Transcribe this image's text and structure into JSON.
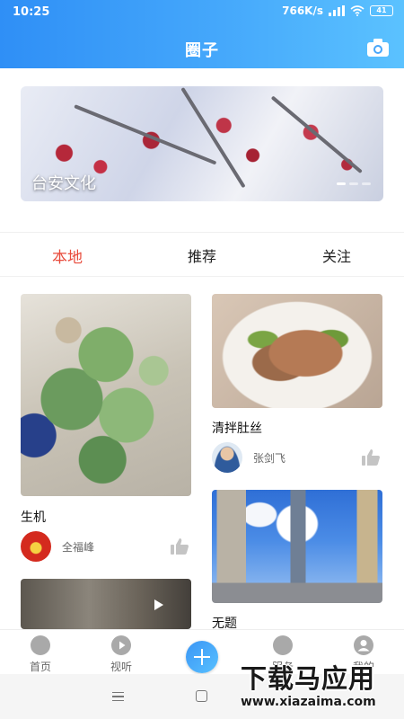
{
  "status_bar": {
    "time": "10:25",
    "network_speed": "766K/s",
    "battery": "41"
  },
  "header": {
    "title": "圈子",
    "camera_icon": "camera-icon"
  },
  "banner": {
    "caption": "台安文化",
    "slide_count": 3,
    "active_slide": 1
  },
  "tabs": [
    {
      "label": "本地",
      "active": true
    },
    {
      "label": "推荐",
      "active": false
    },
    {
      "label": "关注",
      "active": false
    }
  ],
  "feed": {
    "left": [
      {
        "title": "生机",
        "author": "全福峰",
        "like_icon": "thumbs-up-icon"
      },
      {
        "title": "",
        "author": "",
        "play_icon": "play-icon"
      }
    ],
    "right": [
      {
        "title": "清拌肚丝",
        "author": "张剑飞",
        "like_icon": "thumbs-up-icon"
      },
      {
        "title": "无题",
        "author": ""
      }
    ]
  },
  "bottom_nav": [
    {
      "label": "首页",
      "icon": "home-icon"
    },
    {
      "label": "视听",
      "icon": "play-circle-icon"
    },
    {
      "label": "",
      "icon": "add-icon"
    },
    {
      "label": "服务",
      "icon": "handshake-icon"
    },
    {
      "label": "我的",
      "icon": "user-icon"
    }
  ],
  "watermark": {
    "text": "下载马应用",
    "url": "www.xiazaima.com"
  },
  "colors": {
    "header_start": "#2f8ff6",
    "header_end": "#5bc2ff",
    "tab_active": "#e84c3d"
  }
}
